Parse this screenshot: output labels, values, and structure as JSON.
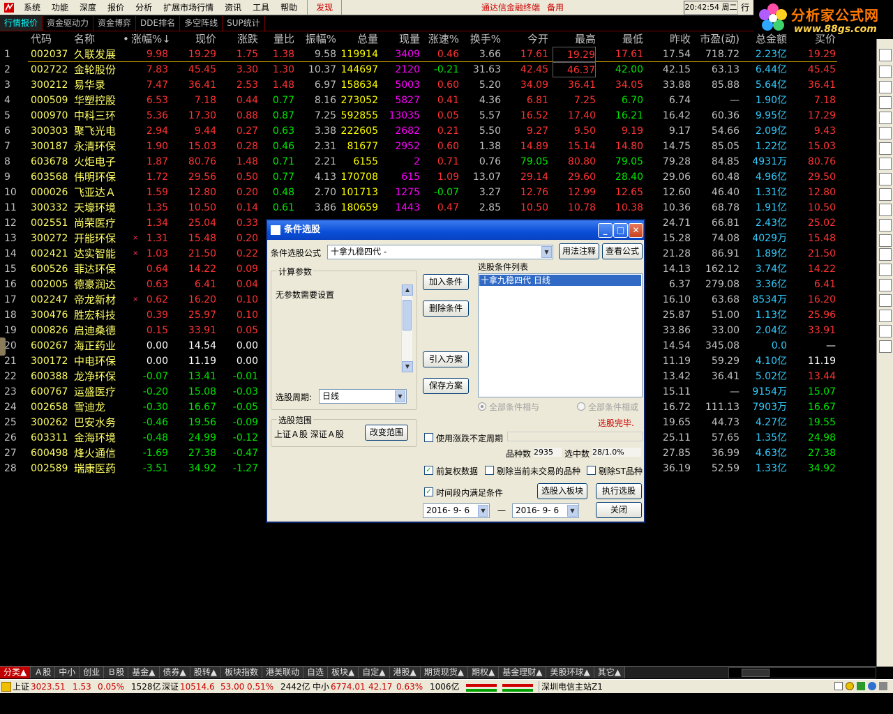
{
  "menubar": {
    "items": [
      "系统",
      "功能",
      "深度",
      "报价",
      "分析",
      "扩展市场行情",
      "资讯",
      "工具",
      "帮助"
    ],
    "discover": "发现",
    "terminal": "通达信金融终端",
    "backup": "备用",
    "clock": "20:42:54 周二",
    "mini": "行"
  },
  "brand": {
    "name": "分析家公式网",
    "url": "www.88gs.com"
  },
  "tabs": [
    "行情报价",
    "资金驱动力",
    "资金博弈",
    "DDE排名",
    "多空阵线",
    "SUP统计"
  ],
  "columns": [
    "代码",
    "名称",
    "•",
    "涨幅%↓",
    "现价",
    "涨跌",
    "量比",
    "振幅%",
    "总量",
    "现量",
    "涨速%",
    "换手%",
    "今开",
    "最高",
    "最低",
    "昨收",
    "市盈(动)",
    "总金额",
    "买价"
  ],
  "rows": [
    {
      "idx": "1",
      "code": "002037",
      "name": "久联发展",
      "mark": "",
      "chg": "9.98",
      "price": "19.29",
      "diff": "1.75",
      "vr": "1.38",
      "amp": "9.58",
      "vol": "119914",
      "cur": "3409",
      "speed": "0.46",
      "turn": "3.66",
      "open": "17.61",
      "high": "19.29",
      "low": "17.61",
      "prev": "17.54",
      "pe": "718.72",
      "amt": "2.23亿",
      "last": "19.29",
      "dir": "up",
      "cur_c": "mag",
      "speed_c": "red",
      "open_c": "red",
      "high_c": "red",
      "low_c": "red",
      "vr_c": "red",
      "last_c": "red"
    },
    {
      "idx": "2",
      "code": "002722",
      "name": "金轮股份",
      "mark": "",
      "chg": "7.83",
      "price": "45.45",
      "diff": "3.30",
      "vr": "1.30",
      "amp": "10.37",
      "vol": "144697",
      "cur": "2120",
      "speed": "-0.21",
      "turn": "31.63",
      "open": "42.45",
      "high": "46.37",
      "low": "42.00",
      "prev": "42.15",
      "pe": "63.13",
      "amt": "6.44亿",
      "last": "45.45",
      "dir": "up",
      "cur_c": "mag",
      "speed_c": "green",
      "open_c": "red",
      "high_c": "red",
      "low_c": "green",
      "vr_c": "red",
      "last_c": "red"
    },
    {
      "idx": "3",
      "code": "300212",
      "name": "易华录",
      "mark": "",
      "chg": "7.47",
      "price": "36.41",
      "diff": "2.53",
      "vr": "1.48",
      "amp": "6.97",
      "vol": "158634",
      "cur": "5003",
      "speed": "0.60",
      "turn": "5.20",
      "open": "34.09",
      "high": "36.41",
      "low": "34.05",
      "prev": "33.88",
      "pe": "85.88",
      "amt": "5.64亿",
      "last": "36.41",
      "dir": "up",
      "cur_c": "mag",
      "speed_c": "red",
      "open_c": "red",
      "high_c": "red",
      "low_c": "red",
      "vr_c": "red",
      "last_c": "red"
    },
    {
      "idx": "4",
      "code": "000509",
      "name": "华塑控股",
      "mark": "",
      "chg": "6.53",
      "price": "7.18",
      "diff": "0.44",
      "vr": "0.77",
      "amp": "8.16",
      "vol": "273052",
      "cur": "5827",
      "speed": "0.41",
      "turn": "4.36",
      "open": "6.81",
      "high": "7.25",
      "low": "6.70",
      "prev": "6.74",
      "pe": "—",
      "amt": "1.90亿",
      "last": "7.18",
      "dir": "up",
      "cur_c": "mag",
      "speed_c": "red",
      "open_c": "red",
      "high_c": "red",
      "low_c": "green",
      "vr_c": "green",
      "last_c": "red"
    },
    {
      "idx": "5",
      "code": "000970",
      "name": "中科三环",
      "mark": "",
      "chg": "5.36",
      "price": "17.30",
      "diff": "0.88",
      "vr": "0.87",
      "amp": "7.25",
      "vol": "592855",
      "cur": "13035",
      "speed": "0.05",
      "turn": "5.57",
      "open": "16.52",
      "high": "17.40",
      "low": "16.21",
      "prev": "16.42",
      "pe": "60.36",
      "amt": "9.95亿",
      "last": "17.29",
      "dir": "up",
      "cur_c": "mag",
      "speed_c": "red",
      "open_c": "red",
      "high_c": "red",
      "low_c": "green",
      "vr_c": "green",
      "last_c": "red"
    },
    {
      "idx": "6",
      "code": "300303",
      "name": "聚飞光电",
      "mark": "",
      "chg": "2.94",
      "price": "9.44",
      "diff": "0.27",
      "vr": "0.63",
      "amp": "3.38",
      "vol": "222605",
      "cur": "2682",
      "speed": "0.21",
      "turn": "5.50",
      "open": "9.27",
      "high": "9.50",
      "low": "9.19",
      "prev": "9.17",
      "pe": "54.66",
      "amt": "2.09亿",
      "last": "9.43",
      "dir": "up",
      "cur_c": "mag",
      "speed_c": "red",
      "open_c": "red",
      "high_c": "red",
      "low_c": "red",
      "vr_c": "green",
      "last_c": "red"
    },
    {
      "idx": "7",
      "code": "300187",
      "name": "永清环保",
      "mark": "",
      "chg": "1.90",
      "price": "15.03",
      "diff": "0.28",
      "vr": "0.46",
      "amp": "2.31",
      "vol": "81677",
      "cur": "2952",
      "speed": "0.60",
      "turn": "1.38",
      "open": "14.89",
      "high": "15.14",
      "low": "14.80",
      "prev": "14.75",
      "pe": "85.05",
      "amt": "1.22亿",
      "last": "15.03",
      "dir": "up",
      "cur_c": "mag",
      "speed_c": "red",
      "open_c": "red",
      "high_c": "red",
      "low_c": "red",
      "vr_c": "green",
      "last_c": "red"
    },
    {
      "idx": "8",
      "code": "603678",
      "name": "火炬电子",
      "mark": "",
      "chg": "1.87",
      "price": "80.76",
      "diff": "1.48",
      "vr": "0.71",
      "amp": "2.21",
      "vol": "6155",
      "cur": "2",
      "speed": "0.71",
      "turn": "0.76",
      "open": "79.05",
      "high": "80.80",
      "low": "79.05",
      "prev": "79.28",
      "pe": "84.85",
      "amt": "4931万",
      "last": "80.76",
      "dir": "up",
      "cur_c": "mag",
      "speed_c": "red",
      "open_c": "green",
      "high_c": "red",
      "low_c": "green",
      "vr_c": "green",
      "last_c": "red"
    },
    {
      "idx": "9",
      "code": "603568",
      "name": "伟明环保",
      "mark": "",
      "chg": "1.72",
      "price": "29.56",
      "diff": "0.50",
      "vr": "0.77",
      "amp": "4.13",
      "vol": "170708",
      "cur": "615",
      "speed": "1.09",
      "turn": "13.07",
      "open": "29.14",
      "high": "29.60",
      "low": "28.40",
      "prev": "29.06",
      "pe": "60.48",
      "amt": "4.96亿",
      "last": "29.50",
      "dir": "up",
      "cur_c": "mag",
      "speed_c": "red",
      "open_c": "red",
      "high_c": "red",
      "low_c": "green",
      "vr_c": "green",
      "last_c": "red"
    },
    {
      "idx": "10",
      "code": "000026",
      "name": "飞亚达Ａ",
      "mark": "",
      "chg": "1.59",
      "price": "12.80",
      "diff": "0.20",
      "vr": "0.48",
      "amp": "2.70",
      "vol": "101713",
      "cur": "1275",
      "speed": "-0.07",
      "turn": "3.27",
      "open": "12.76",
      "high": "12.99",
      "low": "12.65",
      "prev": "12.60",
      "pe": "46.40",
      "amt": "1.31亿",
      "last": "12.80",
      "dir": "up",
      "cur_c": "mag",
      "speed_c": "green",
      "open_c": "red",
      "high_c": "red",
      "low_c": "red",
      "vr_c": "green",
      "last_c": "red"
    },
    {
      "idx": "11",
      "code": "300332",
      "name": "天壕环境",
      "mark": "",
      "chg": "1.35",
      "price": "10.50",
      "diff": "0.14",
      "vr": "0.61",
      "amp": "3.86",
      "vol": "180659",
      "cur": "1443",
      "speed": "0.47",
      "turn": "2.85",
      "open": "10.50",
      "high": "10.78",
      "low": "10.38",
      "prev": "10.36",
      "pe": "68.78",
      "amt": "1.91亿",
      "last": "10.50",
      "dir": "up",
      "cur_c": "mag",
      "speed_c": "red",
      "open_c": "red",
      "high_c": "red",
      "low_c": "red",
      "vr_c": "green",
      "last_c": "red"
    },
    {
      "idx": "12",
      "code": "002551",
      "name": "尚荣医疗",
      "mark": "",
      "chg": "1.34",
      "price": "25.04",
      "diff": "0.33",
      "vr": "",
      "amp": "",
      "vol": "",
      "cur": "",
      "speed": "",
      "turn": "",
      "open": "",
      "high": "",
      "low": "",
      "prev": "24.71",
      "pe": "66.81",
      "amt": "2.43亿",
      "last": "25.02",
      "dir": "up",
      "last_c": "red"
    },
    {
      "idx": "13",
      "code": "300272",
      "name": "开能环保",
      "mark": "×",
      "chg": "1.31",
      "price": "15.48",
      "diff": "0.20",
      "vr": "",
      "amp": "",
      "vol": "",
      "cur": "",
      "speed": "",
      "turn": "",
      "open": "",
      "high": "",
      "low": "",
      "prev": "15.28",
      "pe": "74.08",
      "amt": "4029万",
      "last": "15.48",
      "dir": "up",
      "last_c": "red"
    },
    {
      "idx": "14",
      "code": "002421",
      "name": "达实智能",
      "mark": "×",
      "chg": "1.03",
      "price": "21.50",
      "diff": "0.22",
      "vr": "",
      "amp": "",
      "vol": "",
      "cur": "",
      "speed": "",
      "turn": "",
      "open": "",
      "high": "",
      "low": "",
      "prev": "21.28",
      "pe": "86.91",
      "amt": "1.89亿",
      "last": "21.50",
      "dir": "up",
      "last_c": "red"
    },
    {
      "idx": "15",
      "code": "600526",
      "name": "菲达环保",
      "mark": "",
      "chg": "0.64",
      "price": "14.22",
      "diff": "0.09",
      "vr": "",
      "amp": "",
      "vol": "",
      "cur": "",
      "speed": "",
      "turn": "",
      "open": "",
      "high": "",
      "low": "",
      "prev": "14.13",
      "pe": "162.12",
      "amt": "3.74亿",
      "last": "14.22",
      "dir": "up",
      "last_c": "red"
    },
    {
      "idx": "16",
      "code": "002005",
      "name": "德豪润达",
      "mark": "",
      "chg": "0.63",
      "price": "6.41",
      "diff": "0.04",
      "vr": "",
      "amp": "",
      "vol": "",
      "cur": "",
      "speed": "",
      "turn": "",
      "open": "",
      "high": "",
      "low": "",
      "prev": "6.37",
      "pe": "279.08",
      "amt": "3.36亿",
      "last": "6.41",
      "dir": "up",
      "last_c": "red"
    },
    {
      "idx": "17",
      "code": "002247",
      "name": "帝龙新材",
      "mark": "×",
      "chg": "0.62",
      "price": "16.20",
      "diff": "0.10",
      "vr": "",
      "amp": "",
      "vol": "",
      "cur": "",
      "speed": "",
      "turn": "",
      "open": "",
      "high": "",
      "low": "",
      "prev": "16.10",
      "pe": "63.68",
      "amt": "8534万",
      "last": "16.20",
      "dir": "up",
      "last_c": "red"
    },
    {
      "idx": "18",
      "code": "300476",
      "name": "胜宏科技",
      "mark": "",
      "chg": "0.39",
      "price": "25.97",
      "diff": "0.10",
      "vr": "",
      "amp": "",
      "vol": "",
      "cur": "",
      "speed": "",
      "turn": "",
      "open": "",
      "high": "",
      "low": "",
      "prev": "25.87",
      "pe": "51.00",
      "amt": "1.13亿",
      "last": "25.96",
      "dir": "up",
      "last_c": "red"
    },
    {
      "idx": "19",
      "code": "000826",
      "name": "启迪桑德",
      "mark": "",
      "chg": "0.15",
      "price": "33.91",
      "diff": "0.05",
      "vr": "",
      "amp": "",
      "vol": "",
      "cur": "",
      "speed": "",
      "turn": "",
      "open": "",
      "high": "",
      "low": "",
      "prev": "33.86",
      "pe": "33.00",
      "amt": "2.04亿",
      "last": "33.91",
      "dir": "up",
      "last_c": "red"
    },
    {
      "idx": "20",
      "code": "600267",
      "name": "海正药业",
      "mark": "",
      "chg": "0.00",
      "price": "14.54",
      "diff": "0.00",
      "vr": "",
      "amp": "",
      "vol": "",
      "cur": "",
      "speed": "",
      "turn": "",
      "open": "",
      "high": "",
      "low": "",
      "prev": "14.54",
      "pe": "345.08",
      "amt": "0.0",
      "last": "—",
      "dir": "flat",
      "last_c": "white"
    },
    {
      "idx": "21",
      "code": "300172",
      "name": "中电环保",
      "mark": "",
      "chg": "0.00",
      "price": "11.19",
      "diff": "0.00",
      "vr": "",
      "amp": "",
      "vol": "",
      "cur": "",
      "speed": "",
      "turn": "",
      "open": "",
      "high": "",
      "low": "",
      "prev": "11.19",
      "pe": "59.29",
      "amt": "4.10亿",
      "last": "11.19",
      "dir": "flat",
      "last_c": "white"
    },
    {
      "idx": "22",
      "code": "600388",
      "name": "龙净环保",
      "mark": "",
      "chg": "-0.07",
      "price": "13.41",
      "diff": "-0.01",
      "vr": "",
      "amp": "",
      "vol": "",
      "cur": "",
      "speed": "",
      "turn": "",
      "open": "",
      "high": "",
      "low": "",
      "prev": "13.42",
      "pe": "36.41",
      "amt": "5.02亿",
      "last": "13.44",
      "dir": "down",
      "last_c": "red"
    },
    {
      "idx": "23",
      "code": "600767",
      "name": "运盛医疗",
      "mark": "",
      "chg": "-0.20",
      "price": "15.08",
      "diff": "-0.03",
      "vr": "",
      "amp": "",
      "vol": "",
      "cur": "",
      "speed": "",
      "turn": "",
      "open": "",
      "high": "",
      "low": "",
      "prev": "15.11",
      "pe": "—",
      "amt": "9154万",
      "last": "15.07",
      "dir": "down",
      "last_c": "green"
    },
    {
      "idx": "24",
      "code": "002658",
      "name": "雪迪龙",
      "mark": "",
      "chg": "-0.30",
      "price": "16.67",
      "diff": "-0.05",
      "vr": "",
      "amp": "",
      "vol": "",
      "cur": "",
      "speed": "",
      "turn": "",
      "open": "",
      "high": "",
      "low": "",
      "prev": "16.72",
      "pe": "111.13",
      "amt": "7903万",
      "last": "16.67",
      "dir": "down",
      "last_c": "green"
    },
    {
      "idx": "25",
      "code": "300262",
      "name": "巴安水务",
      "mark": "",
      "chg": "-0.46",
      "price": "19.56",
      "diff": "-0.09",
      "vr": "",
      "amp": "",
      "vol": "",
      "cur": "",
      "speed": "",
      "turn": "",
      "open": "",
      "high": "",
      "low": "",
      "prev": "19.65",
      "pe": "44.73",
      "amt": "4.27亿",
      "last": "19.55",
      "dir": "down",
      "last_c": "green"
    },
    {
      "idx": "26",
      "code": "603311",
      "name": "金海环境",
      "mark": "",
      "chg": "-0.48",
      "price": "24.99",
      "diff": "-0.12",
      "vr": "",
      "amp": "",
      "vol": "",
      "cur": "",
      "speed": "",
      "turn": "",
      "open": "",
      "high": "",
      "low": "",
      "prev": "25.11",
      "pe": "57.65",
      "amt": "1.35亿",
      "last": "24.98",
      "dir": "down",
      "last_c": "green"
    },
    {
      "idx": "27",
      "code": "600498",
      "name": "烽火通信",
      "mark": "",
      "chg": "-1.69",
      "price": "27.38",
      "diff": "-0.47",
      "vr": "",
      "amp": "",
      "vol": "",
      "cur": "",
      "speed": "",
      "turn": "",
      "open": "",
      "high": "",
      "low": "",
      "prev": "27.85",
      "pe": "36.99",
      "amt": "4.63亿",
      "last": "27.38",
      "dir": "down",
      "last_c": "green"
    },
    {
      "idx": "28",
      "code": "002589",
      "name": "瑞康医药",
      "mark": "",
      "chg": "-3.51",
      "price": "34.92",
      "diff": "-1.27",
      "vr": "",
      "amp": "",
      "vol": "",
      "cur": "",
      "speed": "",
      "turn": "",
      "open": "",
      "high": "",
      "low": "",
      "prev": "36.19",
      "pe": "52.59",
      "amt": "1.33亿",
      "last": "34.92",
      "dir": "down",
      "last_c": "green"
    }
  ],
  "dialog": {
    "title": "条件选股",
    "formula_label": "条件选股公式",
    "formula_value": "十拿九稳四代 -",
    "usage_button": "用法注释",
    "view_formula_button": "查看公式",
    "params_group": "计算参数",
    "params_text": "无参数需要设置",
    "period_label": "选股周期:",
    "period_value": "日线",
    "add_button": "加入条件",
    "delete_button": "删除条件",
    "import_button": "引入方案",
    "save_button": "保存方案",
    "conditions_label": "选股条件列表",
    "conditions": [
      "十拿九稳四代  日线"
    ],
    "and_label": "全部条件相与",
    "or_label": "全部条件相或",
    "status": "选股完毕.",
    "range_group": "选股范围",
    "range_text": "上证Ａ股  深证Ａ股",
    "change_range_button": "改变范围",
    "use_period_label": "使用涨跌不定周期",
    "count_label": "品种数",
    "count_value": "2935",
    "hit_label": "选中数",
    "hit_value": "28/1.0%",
    "restore_label": "前复权数据",
    "exclude_no_trade_label": "剔除当前未交易的品种",
    "exclude_st_label": "剔除ST品种",
    "time_range_label": "时间段内满足条件",
    "to_block_button": "选股入板块",
    "run_button": "执行选股",
    "close_button": "关闭",
    "date_from": "2016- 9- 6",
    "date_to": "2016- 9- 6",
    "dash": "—"
  },
  "categories": [
    "分类▲",
    "Ａ股",
    "中小",
    "创业",
    "Ｂ股",
    "基金▲",
    "债券▲",
    "股转▲",
    "板块指数",
    "港美联动",
    "自选",
    "板块▲",
    "自定▲",
    "港股▲",
    "期货现货▲",
    "期权▲",
    "基金理财▲",
    "美股环球▲",
    "其它▲"
  ],
  "statusbar": {
    "sh_label": "上证",
    "sh_value": "3023.51",
    "sh_diff": "1.53",
    "sh_pct": "0.05%",
    "sh_amt": "1528亿",
    "sz_label": "深证",
    "sz_value": "10514.6",
    "sz_diff": "53.00",
    "sz_pct": "0.51%",
    "sz_amt": "2442亿",
    "zx_label": "中小",
    "zx_value": "6774.01",
    "zx_diff": "42.17",
    "zx_pct": "0.63%",
    "zx_amt": "1006亿",
    "server": "深圳电信主站Z1"
  },
  "colors": {
    "up": "#ff3333",
    "down": "#00e600",
    "code": "#ffff66",
    "amount": "#33ccff",
    "volume": "#ffff00",
    "current": "#ff00ff"
  }
}
